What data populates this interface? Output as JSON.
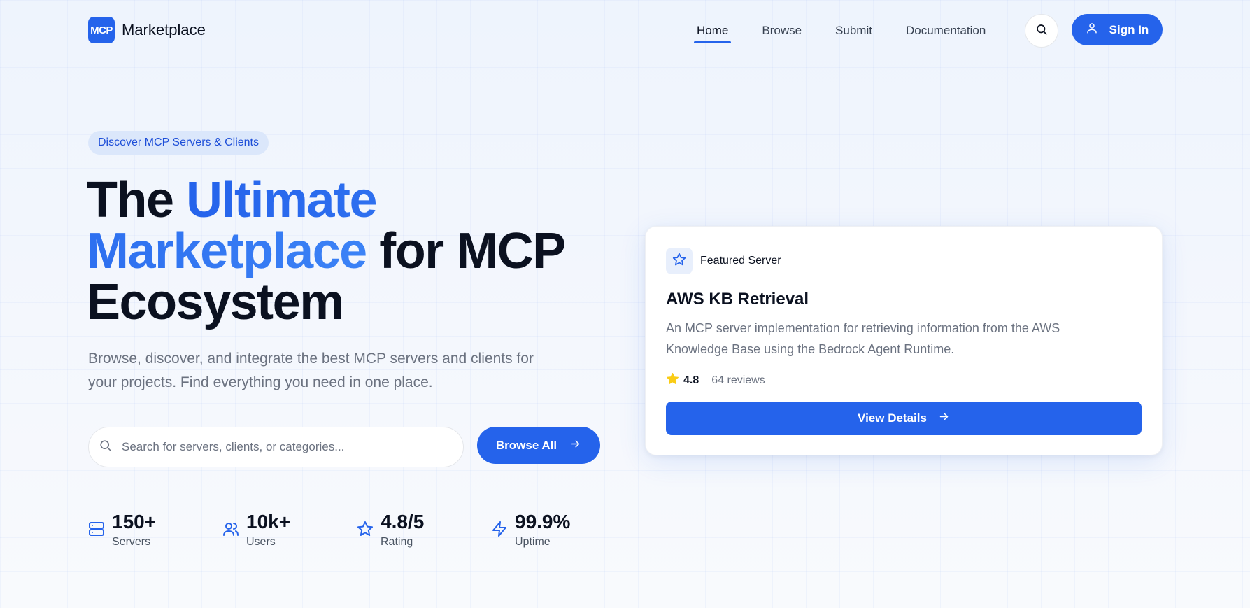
{
  "nav": {
    "logo_text": "MCP",
    "brand": "Marketplace",
    "links": [
      "Home",
      "Browse",
      "Submit",
      "Documentation"
    ],
    "active_link": "Home",
    "signin_label": "Sign In"
  },
  "hero": {
    "badge": "Discover MCP Servers & Clients",
    "title_plain_1": "The ",
    "title_accent": "Ultimate Marketplace",
    "title_plain_2": " for MCP Ecosystem",
    "subtitle": "Browse, discover, and integrate the best MCP servers and clients for your projects. Find everything you need in one place.",
    "search_placeholder": "Search for servers, clients, or categories...",
    "browse_label": "Browse All"
  },
  "stats": [
    {
      "value": "150+",
      "label": "Servers",
      "icon": "server-icon"
    },
    {
      "value": "10k+",
      "label": "Users",
      "icon": "users-icon"
    },
    {
      "value": "4.8/5",
      "label": "Rating",
      "icon": "star-icon"
    },
    {
      "value": "99.9%",
      "label": "Uptime",
      "icon": "zap-icon"
    }
  ],
  "featured": {
    "kicker": "Featured Server",
    "title": "AWS KB Retrieval",
    "description": "An MCP server implementation for retrieving information from the AWS Knowledge Base using the Bedrock Agent Runtime.",
    "rating": "4.8",
    "reviews": "64 reviews",
    "button_label": "View Details"
  },
  "colors": {
    "accent": "#2563eb",
    "star": "#facc15",
    "text": "#0b1120",
    "muted": "#6b7280"
  }
}
